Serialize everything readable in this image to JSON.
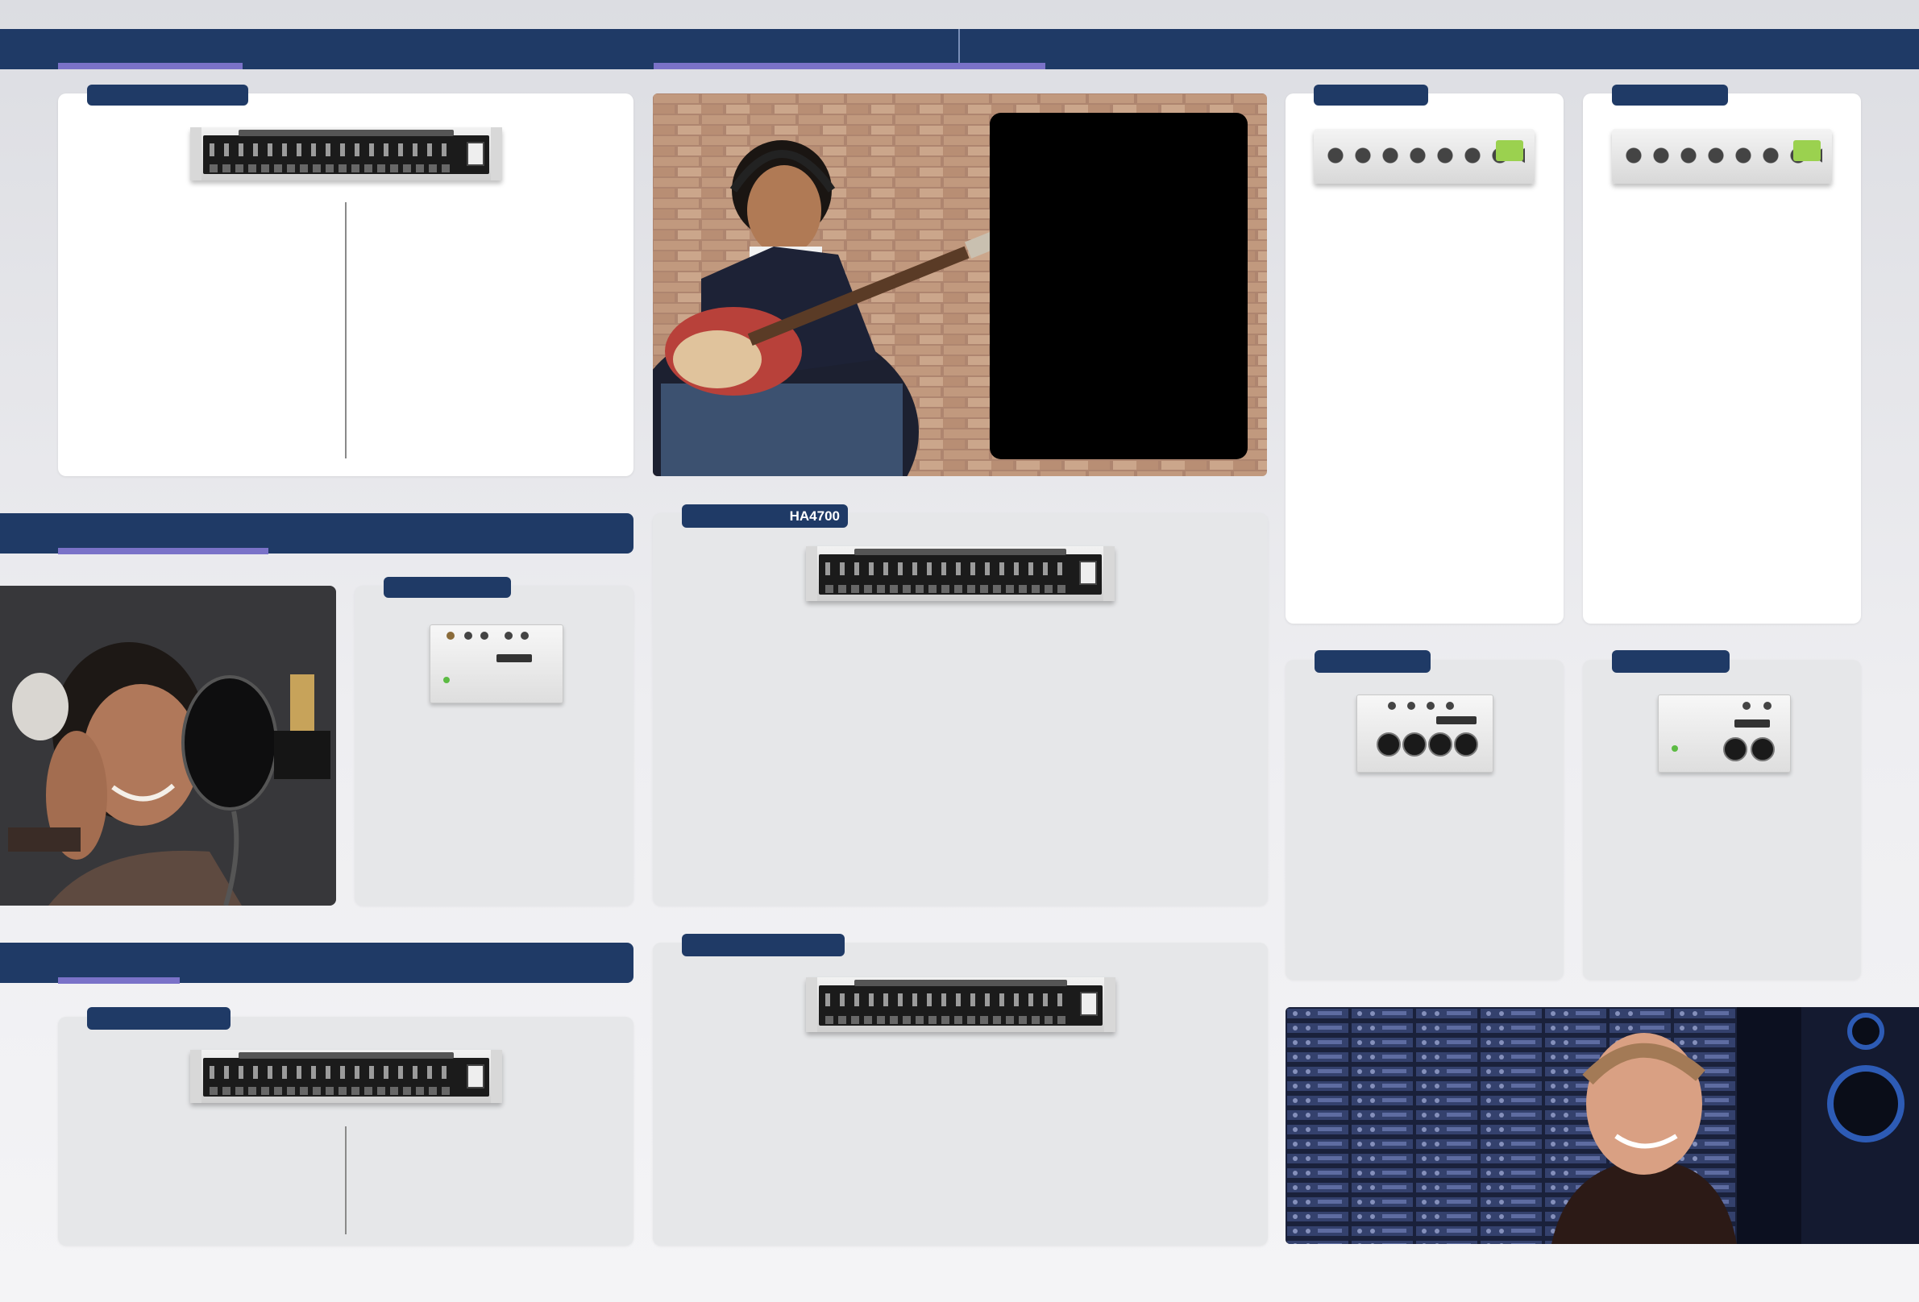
{
  "products": {
    "ha4700_label": "HA4700"
  },
  "colors": {
    "band": "#1f3a66",
    "accent": "#7a72c8",
    "panel_white": "#ffffff",
    "panel_gray": "#e6e7e9"
  },
  "icons": {
    "ultramatch": "rack-unit-icon",
    "powerplay_4700": "rack-unit-icon",
    "powerplay_8": "rack-unit-icon",
    "multigate": "rack-unit-icon",
    "pp400": "desktop-unit-icon",
    "ha400": "desktop-unit-icon",
    "ma400": "desktop-unit-icon",
    "mini_amp": "desktop-unit-icon",
    "mini_mon": "desktop-unit-icon"
  }
}
